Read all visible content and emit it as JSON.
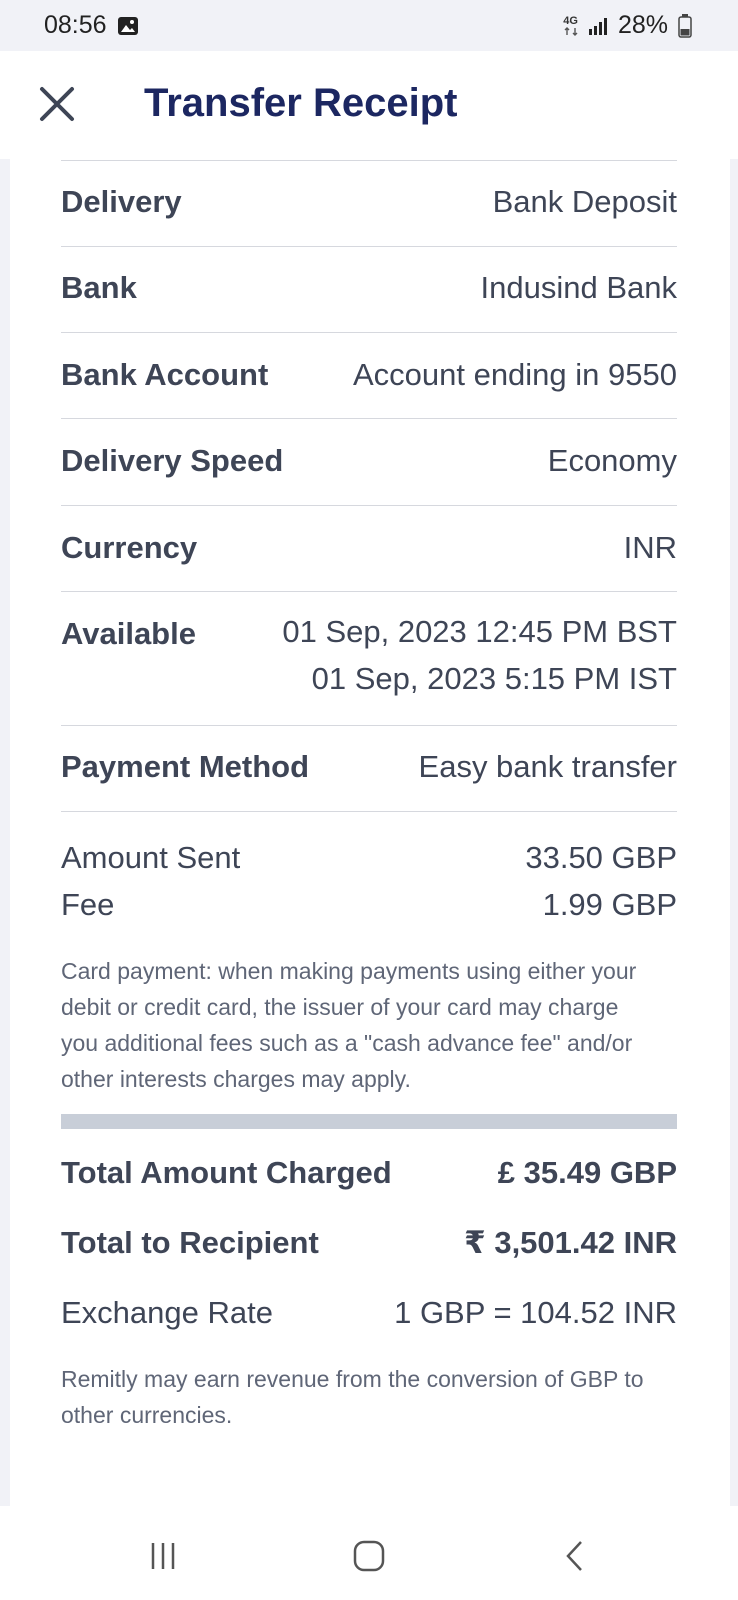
{
  "status_bar": {
    "time": "08:56",
    "network": "4G",
    "battery": "28%",
    "icons": [
      "gallery-icon",
      "network-icon",
      "signal-icon",
      "battery-icon"
    ]
  },
  "header": {
    "title": "Transfer Receipt",
    "close_icon": "close-icon"
  },
  "details": [
    {
      "label": "Delivery",
      "value": "Bank Deposit"
    },
    {
      "label": "Bank",
      "value": "Indusind Bank"
    },
    {
      "label": "Bank Account",
      "value": "Account ending in 9550"
    },
    {
      "label": "Delivery Speed",
      "value": "Economy"
    },
    {
      "label": "Currency",
      "value": "INR"
    },
    {
      "label": "Available",
      "value": "01 Sep, 2023 12:45 PM BST",
      "value2": "01 Sep, 2023 5:15 PM IST"
    },
    {
      "label": "Payment Method",
      "value": "Easy bank transfer"
    }
  ],
  "amounts": {
    "amount_sent_label": "Amount Sent",
    "amount_sent_value": "33.50 GBP",
    "fee_label": "Fee",
    "fee_value": "1.99 GBP"
  },
  "card_note": "Card payment: when making payments using either your debit or credit card, the issuer of your card may charge you additional fees such as a \"cash advance fee\" and/or other interests charges may apply.",
  "totals": {
    "total_charged_label": "Total Amount Charged",
    "total_charged_value": "£ 35.49 GBP",
    "total_recipient_label": "Total to Recipient",
    "total_recipient_value": "₹ 3,501.42 INR",
    "exchange_rate_label": "Exchange Rate",
    "exchange_rate_value": "1 GBP = 104.52 INR"
  },
  "revenue_note": "Remitly may earn revenue from the conversion of GBP to other currencies.",
  "nav": {
    "icons": [
      "recent-apps-icon",
      "home-icon",
      "back-icon"
    ]
  },
  "colors": {
    "title": "#1c2761",
    "text": "#3e4556",
    "note": "#5f6677",
    "divider": "#d6d8de",
    "separator": "#c8ced8",
    "background": "#f1f2f7"
  }
}
